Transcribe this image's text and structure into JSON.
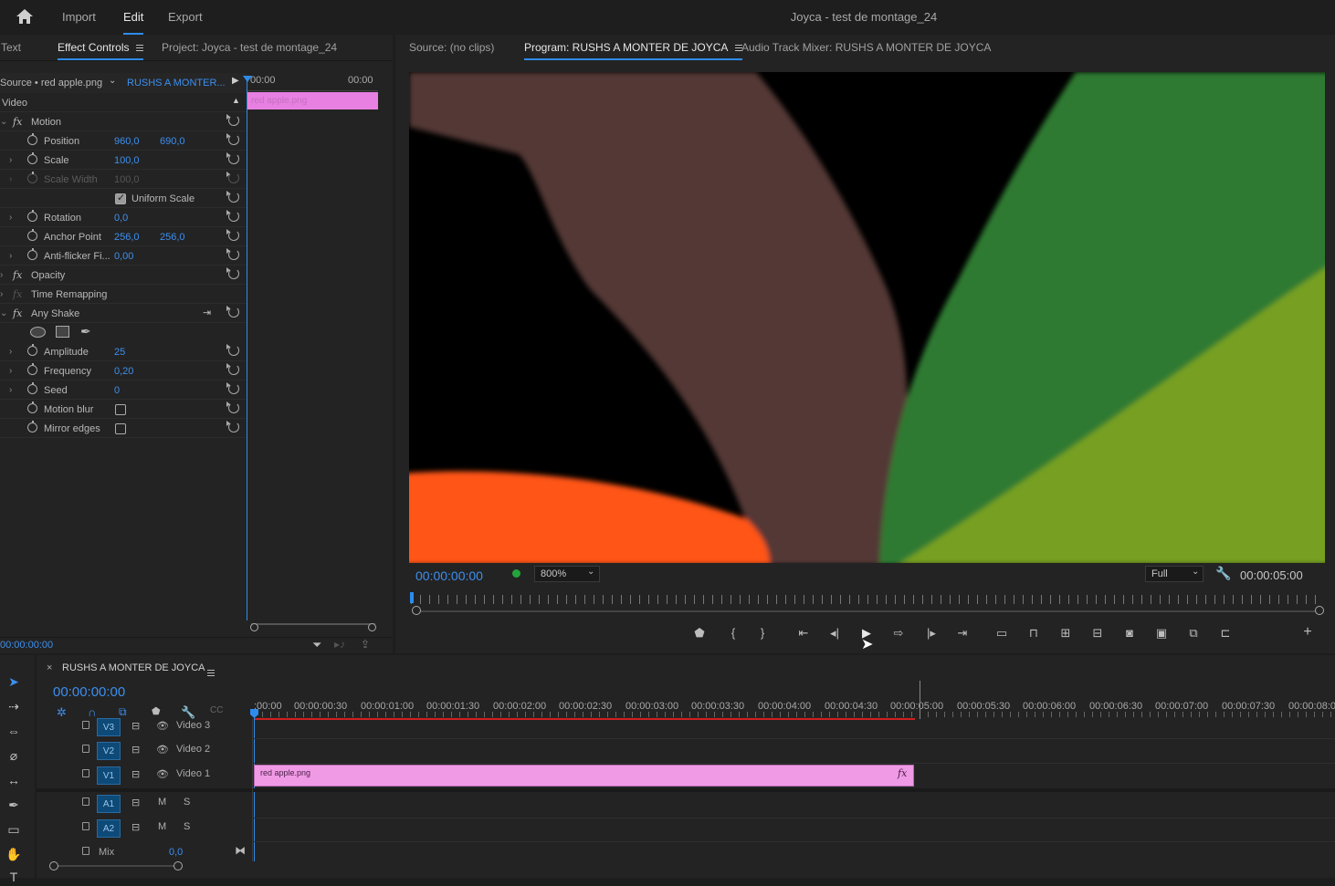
{
  "menu": {
    "import": "Import",
    "edit": "Edit",
    "export": "Export"
  },
  "app_title": "Joyca - test de montage_24",
  "left_tabs": {
    "text": "Text",
    "effect_controls": "Effect Controls",
    "project": "Project: Joyca - test de montage_24"
  },
  "ec_source": {
    "source": "Source • red apple.png",
    "sequence": "RUSHS A MONTER...",
    "time_start": "00:00",
    "time_end": "00:00",
    "clip_name": "red apple.png"
  },
  "ec_section": "Video",
  "ec_rows": [
    {
      "label": "Motion",
      "kind": "fx"
    },
    {
      "label": "Position",
      "v1": "960,0",
      "v2": "690,0"
    },
    {
      "label": "Scale",
      "v1": "100,0"
    },
    {
      "label": "Scale Width",
      "v1": "100,0"
    },
    {
      "label": "Uniform Scale"
    },
    {
      "label": "Rotation",
      "v1": "0,0"
    },
    {
      "label": "Anchor Point",
      "v1": "256,0",
      "v2": "256,0"
    },
    {
      "label": "Anti-flicker Fi...",
      "v1": "0,00"
    },
    {
      "label": "Opacity",
      "kind": "fx"
    },
    {
      "label": "Time Remapping",
      "kind": "fx"
    },
    {
      "label": "Any Shake",
      "kind": "fx"
    },
    {
      "label": "Amplitude",
      "v1": "25"
    },
    {
      "label": "Frequency",
      "v1": "0,20"
    },
    {
      "label": "Seed",
      "v1": "0"
    },
    {
      "label": "Motion blur"
    },
    {
      "label": "Mirror edges"
    }
  ],
  "ec_timecode": "00:00:00:00",
  "monitor_tabs": {
    "source": "Source: (no clips)",
    "program": "Program: RUSHS A MONTER DE JOYCA",
    "audio_mixer": "Audio Track Mixer: RUSHS A MONTER DE JOYCA"
  },
  "monitor": {
    "timecode": "00:00:00:00",
    "zoom": "800%",
    "quality": "Full",
    "duration": "00:00:05:00"
  },
  "timeline": {
    "title": "RUSHS A MONTER DE JOYCA",
    "timecode": "00:00:00:00",
    "ticks": [
      ":00:00",
      "00:00:00:30",
      "00:00:01:00",
      "00:00:01:30",
      "00:00:02:00",
      "00:00:02:30",
      "00:00:03:00",
      "00:00:03:30",
      "00:00:04:00",
      "00:00:04:30",
      "00:00:05:00",
      "00:00:05:30",
      "00:00:06:00",
      "00:00:06:30",
      "00:00:07:00",
      "00:00:07:30",
      "00:00:08:0"
    ],
    "tracks": [
      {
        "id": "V3",
        "name": "Video 3"
      },
      {
        "id": "V2",
        "name": "Video 2"
      },
      {
        "id": "V1",
        "name": "Video 1"
      },
      {
        "id": "A1",
        "m": "M",
        "s": "S"
      },
      {
        "id": "A2",
        "m": "M",
        "s": "S"
      }
    ],
    "mix_label": "Mix",
    "mix_value": "0,0",
    "clip_name": "red apple.png",
    "clip_fx": "fx"
  },
  "colors": {
    "accent": "#2d8ceb",
    "clip": "#f09ae6",
    "value_blue": "#3c8ff0",
    "track_id": "#0d4a78"
  }
}
